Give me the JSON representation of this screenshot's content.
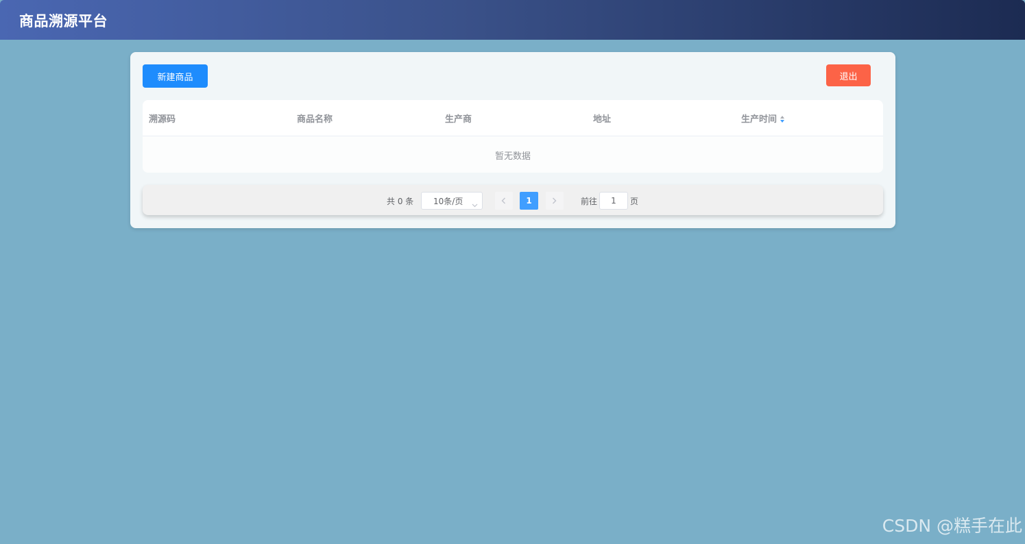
{
  "header": {
    "title": "商品溯源平台"
  },
  "toolbar": {
    "new_product_label": "新建商品",
    "logout_label": "退出"
  },
  "table": {
    "columns": [
      "溯源码",
      "商品名称",
      "生产商",
      "地址",
      "生产时间"
    ],
    "sortable_column": "生产时间",
    "rows": [],
    "empty_text": "暂无数据"
  },
  "pagination": {
    "total_text": "共 0 条",
    "page_size": "10条/页",
    "current_page": "1",
    "goto_label": "前往",
    "goto_value": "1",
    "page_suffix": "页"
  },
  "watermark": {
    "text": "CSDN @糕手在此"
  },
  "colors": {
    "background": "#7aafc8",
    "header_start": "#4a67b2",
    "header_end": "#1c2b52",
    "primary": "#1e8cfd",
    "danger": "#fc6347",
    "page_active": "#409eff"
  },
  "icons": {
    "sort": "sort-caret-icon",
    "select": "chevron-down-icon",
    "prev": "chevron-left-icon",
    "next": "chevron-right-icon"
  }
}
